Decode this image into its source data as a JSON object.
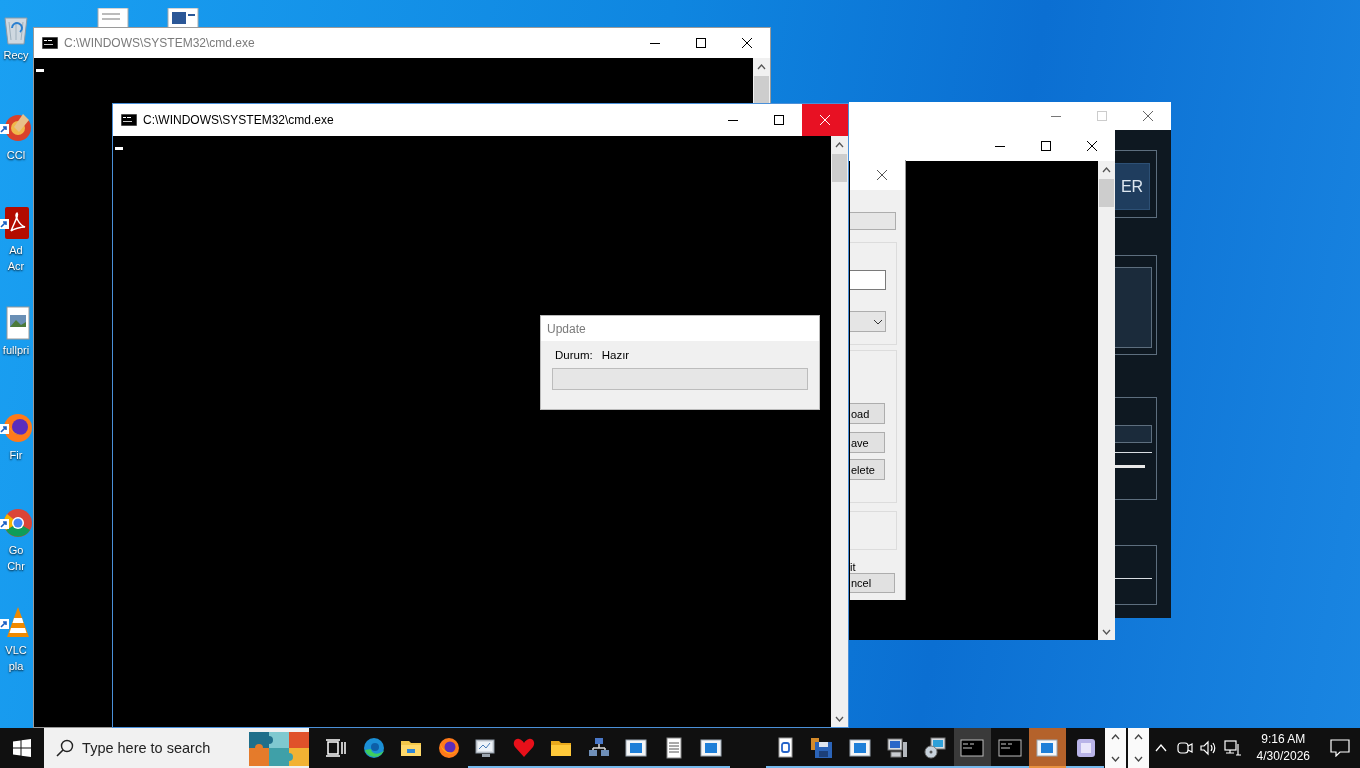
{
  "desktop_icons": [
    {
      "kind": "recycle",
      "lines": [
        "Recy"
      ]
    },
    {
      "kind": "cleaner",
      "lines": [
        "CCl"
      ]
    },
    {
      "kind": "pdf",
      "lines": [
        "Ad",
        "Acr"
      ]
    },
    {
      "kind": "image",
      "lines": [
        "fullpri"
      ]
    },
    {
      "kind": "firefox",
      "lines": [
        "Fir"
      ]
    },
    {
      "kind": "chrome",
      "lines": [
        "Go",
        "Chr"
      ]
    },
    {
      "kind": "vlc",
      "lines": [
        "VLC",
        "pla"
      ]
    }
  ],
  "windows": [
    {
      "kind": "dark_app",
      "active": false,
      "button": "ER"
    },
    {
      "kind": "console_back",
      "active": false
    },
    {
      "kind": "settings",
      "active": false,
      "buttons": [
        "oad",
        "ave",
        "elete"
      ],
      "note": "it",
      "cancel": "ncel"
    },
    {
      "kind": "console",
      "title": "C:\\WINDOWS\\SYSTEM32\\cmd.exe",
      "active": false
    },
    {
      "kind": "console",
      "title": "C:\\WINDOWS\\SYSTEM32\\cmd.exe",
      "active": true
    },
    {
      "kind": "update",
      "title": "Update",
      "active": false,
      "status_label": "Durum:",
      "status_value": "Hazır",
      "progress": {
        "level": 0
      }
    }
  ],
  "taskbar": {
    "search": {
      "placeholder": "Type here to search"
    },
    "items": [
      {
        "kind": "taskview",
        "running": false,
        "focused": false,
        "flashing": false
      },
      {
        "kind": "edge",
        "running": false,
        "focused": false,
        "flashing": false
      },
      {
        "kind": "explorer",
        "running": false,
        "focused": false,
        "flashing": false
      },
      {
        "kind": "firefox",
        "running": false,
        "focused": false,
        "flashing": false
      },
      {
        "kind": "monitor",
        "running": true,
        "focused": false,
        "flashing": false
      },
      {
        "kind": "heart",
        "running": true,
        "focused": false,
        "flashing": false
      },
      {
        "kind": "folder",
        "running": true,
        "focused": false,
        "flashing": false
      },
      {
        "kind": "network",
        "running": true,
        "focused": false,
        "flashing": false
      },
      {
        "kind": "window",
        "running": true,
        "focused": false,
        "flashing": false
      },
      {
        "kind": "notepad",
        "running": true,
        "focused": false,
        "flashing": false
      },
      {
        "kind": "window",
        "running": true,
        "focused": false,
        "flashing": false
      },
      {
        "kind": "document",
        "running": true,
        "focused": false,
        "flashing": false
      },
      {
        "kind": "floppy",
        "running": true,
        "focused": false,
        "flashing": false
      },
      {
        "kind": "window",
        "running": true,
        "focused": false,
        "flashing": false
      },
      {
        "kind": "computer",
        "running": true,
        "focused": false,
        "flashing": false
      },
      {
        "kind": "disc",
        "running": true,
        "focused": false,
        "flashing": false
      },
      {
        "kind": "console",
        "running": true,
        "focused": true,
        "flashing": false
      },
      {
        "kind": "console",
        "running": true,
        "focused": false,
        "flashing": false
      },
      {
        "kind": "window",
        "running": true,
        "focused": false,
        "flashing": true
      },
      {
        "kind": "partial",
        "running": true,
        "focused": false,
        "flashing": false
      }
    ],
    "clock": {
      "time": "9:16 AM",
      "date": "4/30/2026"
    }
  }
}
